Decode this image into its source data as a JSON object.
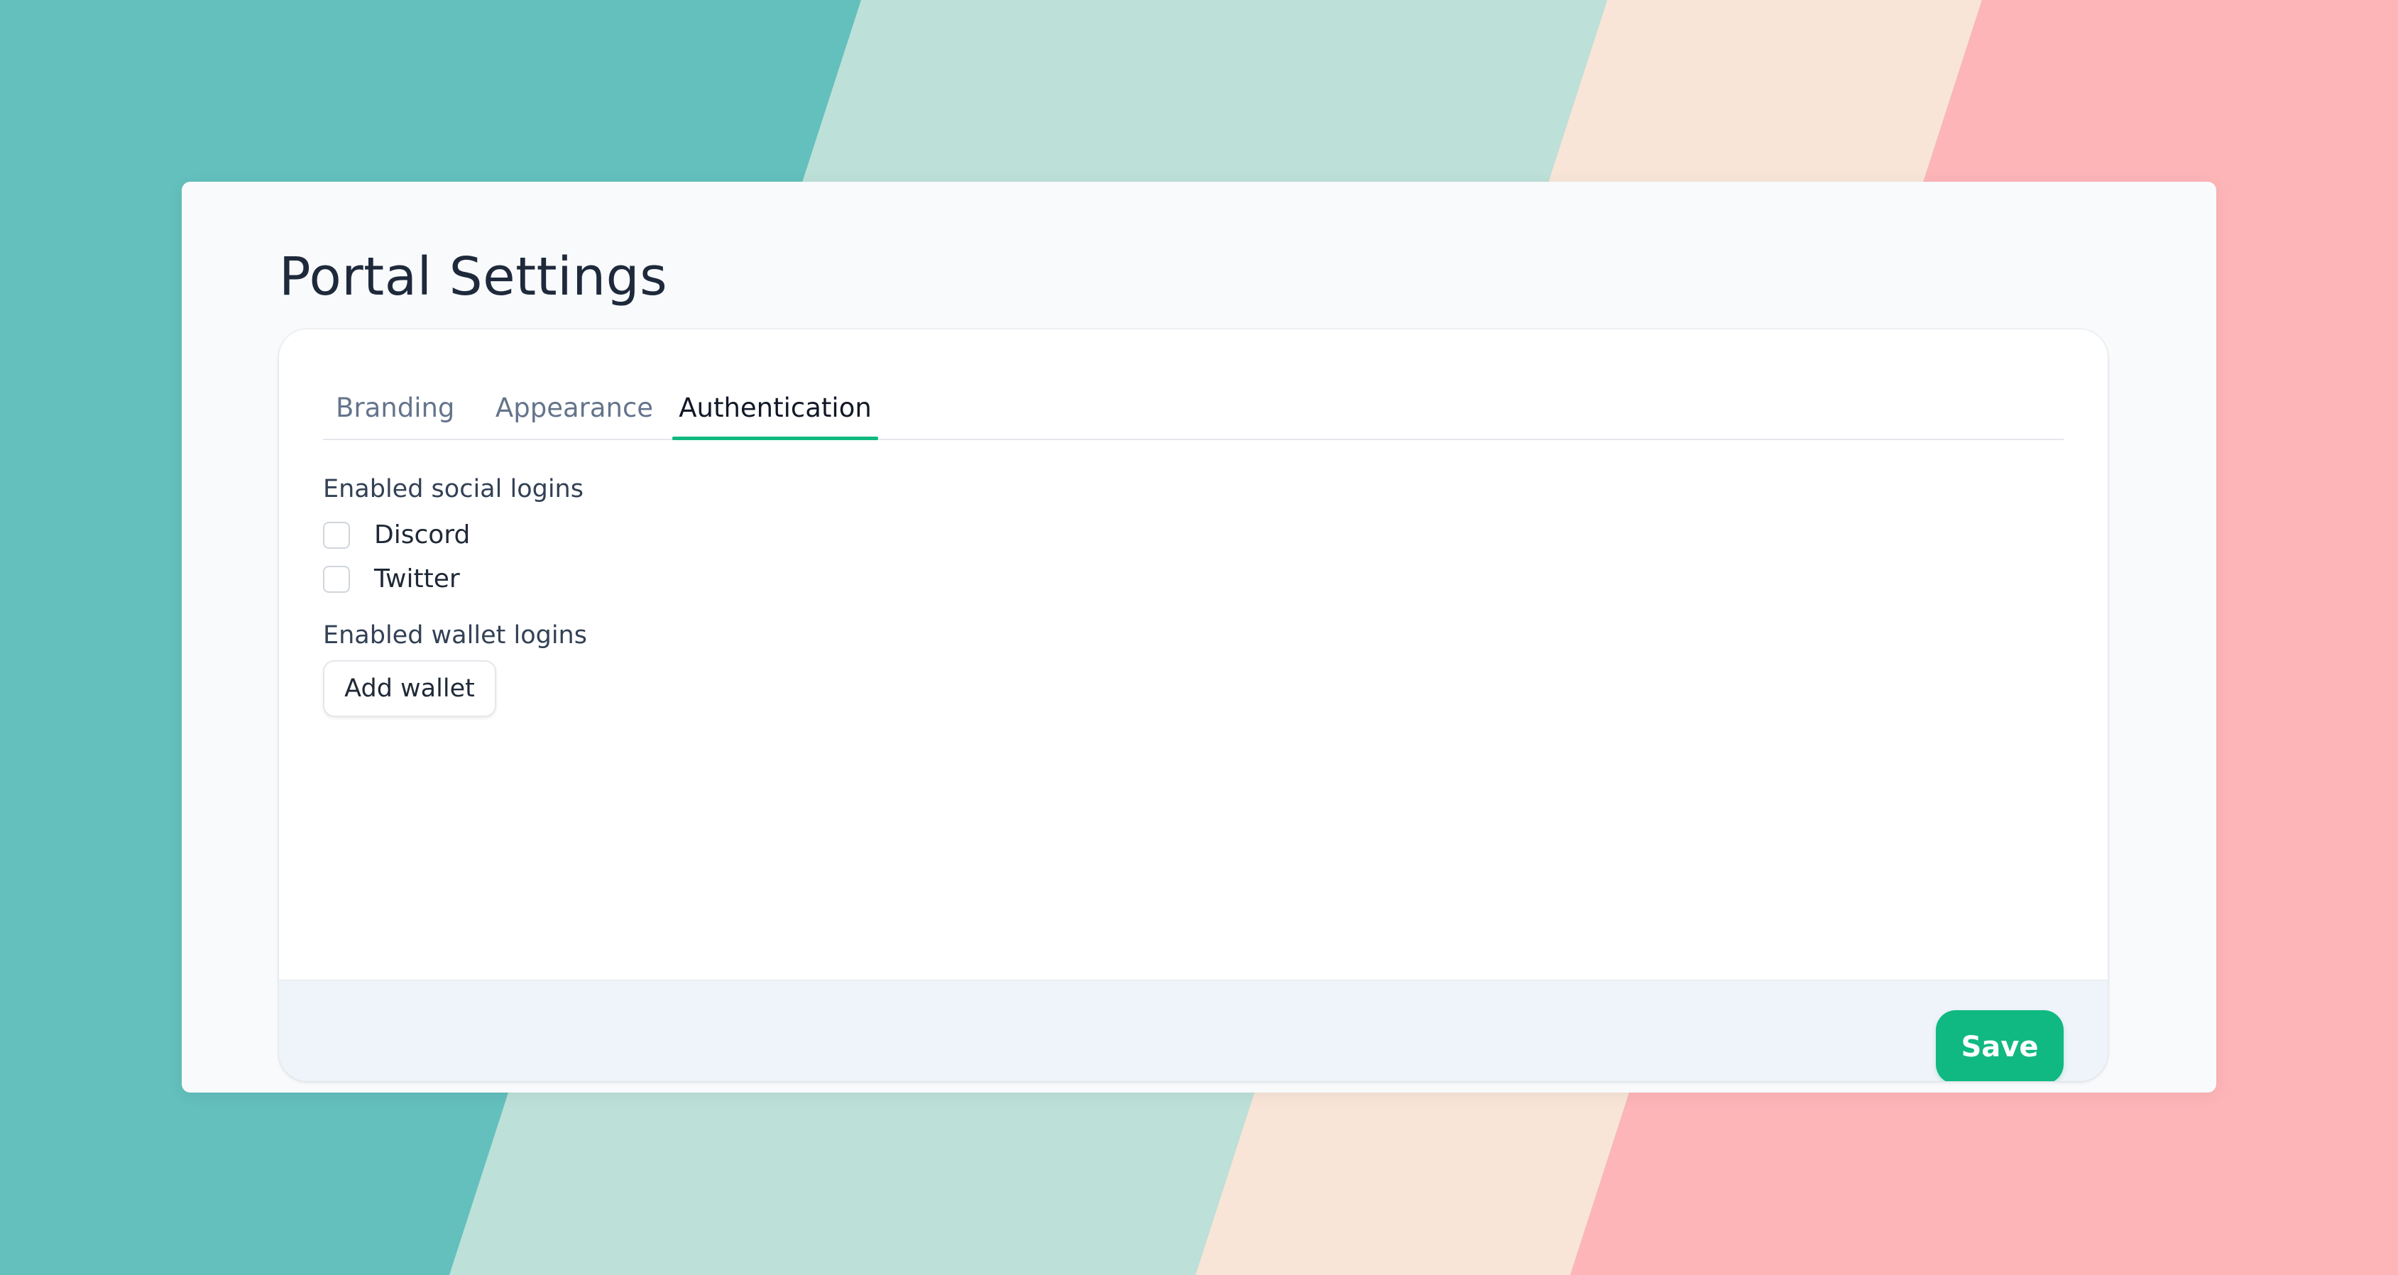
{
  "page": {
    "title": "Portal Settings"
  },
  "tabs": [
    {
      "label": "Branding",
      "active": false
    },
    {
      "label": "Appearance",
      "active": false
    },
    {
      "label": "Authentication",
      "active": true
    }
  ],
  "social_logins": {
    "label": "Enabled social logins",
    "options": [
      {
        "label": "Discord",
        "checked": false
      },
      {
        "label": "Twitter",
        "checked": false
      }
    ]
  },
  "wallet_logins": {
    "label": "Enabled wallet logins",
    "add_button_label": "Add wallet"
  },
  "footer": {
    "save_label": "Save"
  },
  "colors": {
    "accent": "#10b981",
    "background_teal": "#63c0bd",
    "background_mint": "#bde0d8",
    "background_peach": "#f8e5d8",
    "background_pink": "#feb5b8"
  }
}
